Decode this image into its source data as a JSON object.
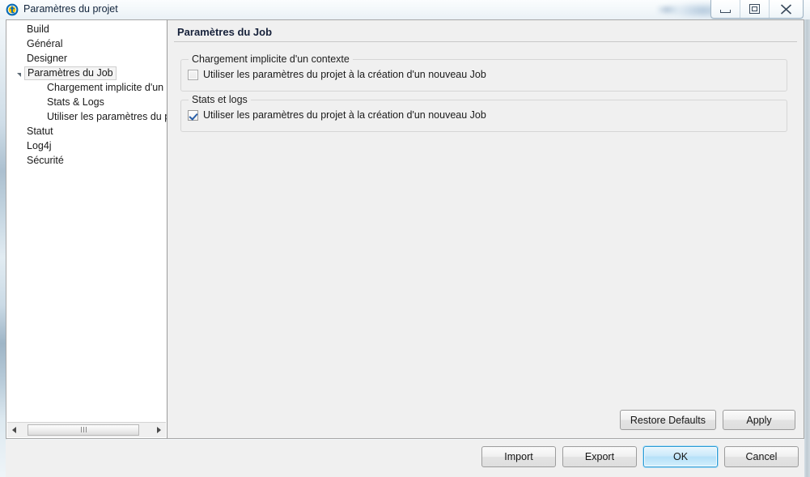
{
  "window": {
    "title": "Paramètres du projet",
    "icon": "talend-logo-icon",
    "controls": {
      "minimize": "minimize-icon",
      "restore": "restore-icon",
      "close": "close-icon"
    }
  },
  "sidebar": {
    "items": [
      {
        "label": "Build",
        "level": 0,
        "twisty": "collapsed",
        "selected": false
      },
      {
        "label": "Général",
        "level": 0,
        "twisty": "collapsed",
        "selected": false
      },
      {
        "label": "Designer",
        "level": 0,
        "twisty": "collapsed",
        "selected": false
      },
      {
        "label": "Paramètres du Job",
        "level": 0,
        "twisty": "expanded",
        "selected": true
      },
      {
        "label": "Chargement implicite d'un co",
        "level": 2,
        "twisty": "none",
        "selected": false
      },
      {
        "label": "Stats & Logs",
        "level": 2,
        "twisty": "none",
        "selected": false
      },
      {
        "label": "Utiliser les paramètres du pro",
        "level": 2,
        "twisty": "none",
        "selected": false
      },
      {
        "label": "Statut",
        "level": 1,
        "twisty": "none",
        "selected": false
      },
      {
        "label": "Log4j",
        "level": 1,
        "twisty": "none",
        "selected": false
      },
      {
        "label": "Sécurité",
        "level": 1,
        "twisty": "none",
        "selected": false
      }
    ],
    "scrollbar": {
      "left_arrow": "scroll-left-icon",
      "right_arrow": "scroll-right-icon"
    }
  },
  "content": {
    "title": "Paramètres du Job",
    "groups": [
      {
        "title": "Chargement implicite d'un contexte",
        "checkbox": {
          "label": "Utiliser les paramètres du projet à la création d'un nouveau Job",
          "checked": false
        }
      },
      {
        "title": "Stats et logs",
        "checkbox": {
          "label": "Utiliser les paramètres du projet à la création d'un nouveau Job",
          "checked": true
        }
      }
    ],
    "buttons": [
      {
        "label": "Restore Defaults",
        "default": false
      },
      {
        "label": "Apply",
        "default": false
      }
    ]
  },
  "footer": {
    "buttons": [
      {
        "label": "Import",
        "default": false
      },
      {
        "label": "Export",
        "default": false
      },
      {
        "label": "OK",
        "default": true
      },
      {
        "label": "Cancel",
        "default": false
      }
    ]
  },
  "colors": {
    "accent": "#2f9bd4",
    "panel_bg": "#f0f0f0",
    "tree_bg": "#ffffff",
    "check_mark": "#2a5fa8"
  }
}
